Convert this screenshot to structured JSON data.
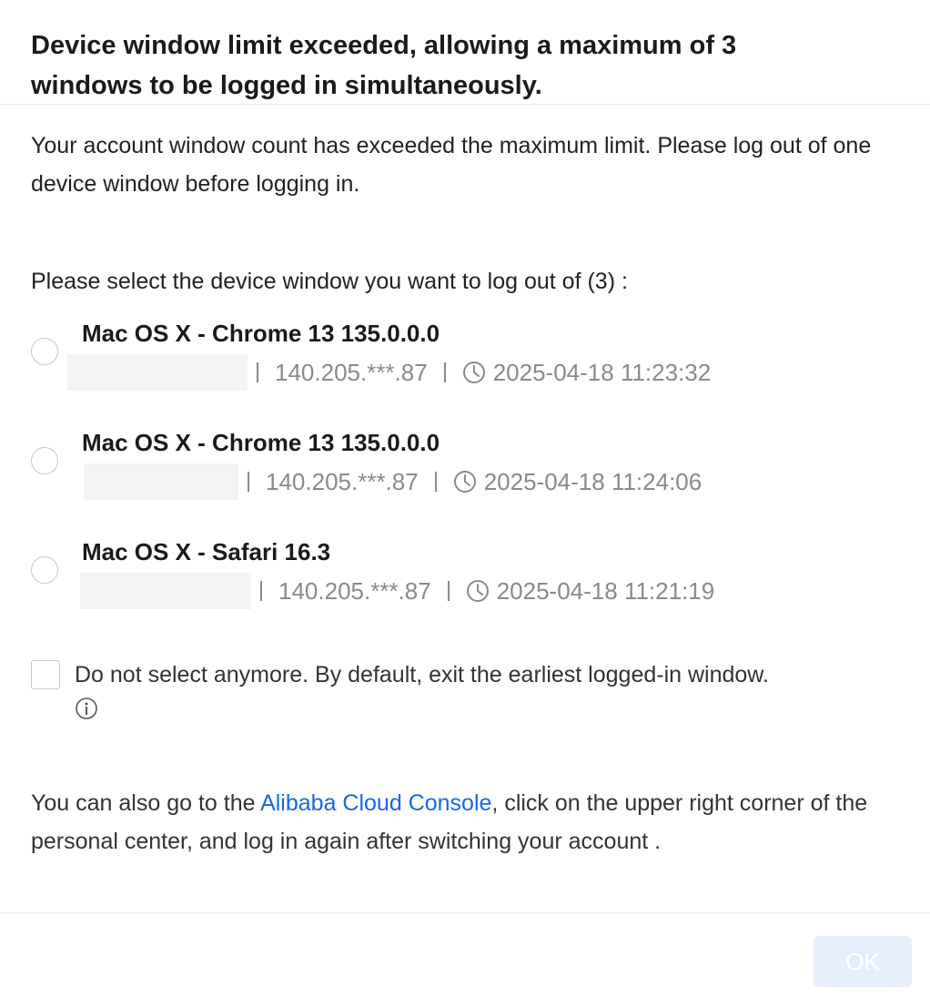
{
  "dialog": {
    "title": "Device window limit exceeded, allowing a maximum of 3 windows to be logged in simultaneously.",
    "description": "Your account window count has exceeded the maximum limit. Please log out of one device window before logging in.",
    "select_prompt": "Please select the device window you want to log out of (3) :",
    "devices": [
      {
        "name": "Mac OS X - Chrome 13 135.0.0.0",
        "ip": "140.205.***.87",
        "time": "2025-04-18 11:23:32",
        "selected": false
      },
      {
        "name": "Mac OS X - Chrome 13 135.0.0.0",
        "ip": "140.205.***.87",
        "time": "2025-04-18 11:24:06",
        "selected": false
      },
      {
        "name": "Mac OS X - Safari 16.3",
        "ip": "140.205.***.87",
        "time": "2025-04-18 11:21:19",
        "selected": false
      }
    ],
    "dont_select_label": "Do not select anymore. By default, exit the earliest logged-in window.",
    "dont_select_checked": false,
    "footer_note_before": "You can also go to the ",
    "footer_link": "Alibaba Cloud Console",
    "footer_note_after": ", click on the upper right corner of the personal center, and log in again after switching your account .",
    "ok_label": "OK"
  },
  "colors": {
    "link": "#1a66e8",
    "ok_disabled_bg": "#e6eefc",
    "muted_text": "#8a8a8a"
  },
  "icons": {
    "radio": "radio-circle",
    "clock": "clock-icon",
    "info": "info-circle-icon",
    "checkbox": "checkbox-square"
  }
}
